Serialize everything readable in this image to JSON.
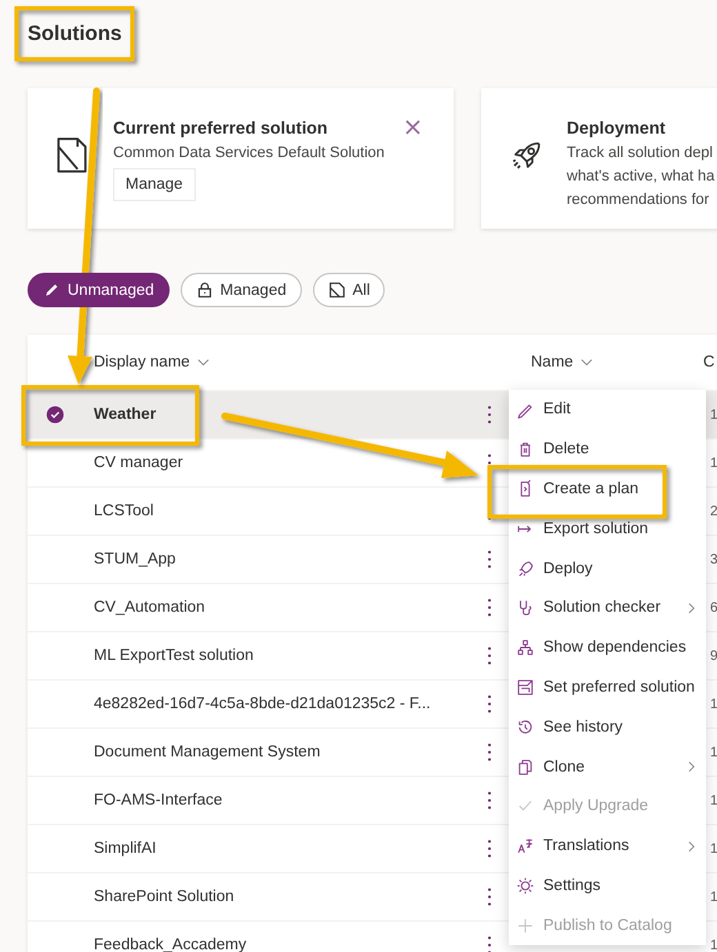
{
  "page": {
    "title": "Solutions"
  },
  "cards": [
    {
      "kind": "preferred",
      "title": "Current preferred solution",
      "lines": [
        "Common Data Services Default Solution"
      ],
      "button": "Manage",
      "close": "×"
    },
    {
      "kind": "deployment",
      "title": "Deployment",
      "lines": [
        "Track all solution depl",
        "what's active, what ha",
        "recommendations for"
      ]
    }
  ],
  "filters": [
    {
      "label": "Unmanaged",
      "selected": true
    },
    {
      "label": "Managed",
      "selected": false
    },
    {
      "label": "All",
      "selected": false
    }
  ],
  "table": {
    "columns": [
      "Display name",
      "Name",
      "C"
    ],
    "rows": [
      {
        "display_name": "Weather",
        "column_3": "1",
        "selected": true
      },
      {
        "display_name": "CV manager",
        "column_3": "1",
        "selected": false
      },
      {
        "display_name": "LCSTool",
        "column_3": "2",
        "selected": false
      },
      {
        "display_name": "STUM_App",
        "column_3": "3",
        "selected": false
      },
      {
        "display_name": "CV_Automation",
        "column_3": "6",
        "selected": false
      },
      {
        "display_name": "ML ExportTest solution",
        "column_3": "9",
        "selected": false
      },
      {
        "display_name": "4e8282ed-16d7-4c5a-8bde-d21da01235c2 - F...",
        "column_3": "1",
        "selected": false
      },
      {
        "display_name": "Document Management System",
        "column_3": "1",
        "selected": false
      },
      {
        "display_name": "FO-AMS-Interface",
        "column_3": "1",
        "selected": false
      },
      {
        "display_name": "SimplifAI",
        "column_3": "1",
        "selected": false
      },
      {
        "display_name": "SharePoint Solution",
        "column_3": "1",
        "selected": false
      },
      {
        "display_name": "Feedback_Accademy",
        "column_3": "1",
        "selected": false
      }
    ]
  },
  "context_menu": [
    {
      "label": "Edit",
      "disabled": false,
      "submenu": false
    },
    {
      "label": "Delete",
      "disabled": false,
      "submenu": false
    },
    {
      "label": "Create a plan",
      "disabled": false,
      "submenu": false
    },
    {
      "label": "Export solution",
      "disabled": false,
      "submenu": false
    },
    {
      "label": "Deploy",
      "disabled": false,
      "submenu": false
    },
    {
      "label": "Solution checker",
      "disabled": false,
      "submenu": true
    },
    {
      "label": "Show dependencies",
      "disabled": false,
      "submenu": false
    },
    {
      "label": "Set preferred solution",
      "disabled": false,
      "submenu": false
    },
    {
      "label": "See history",
      "disabled": false,
      "submenu": false
    },
    {
      "label": "Clone",
      "disabled": false,
      "submenu": true
    },
    {
      "label": "Apply Upgrade",
      "disabled": true,
      "submenu": false
    },
    {
      "label": "Translations",
      "disabled": false,
      "submenu": true
    },
    {
      "label": "Settings",
      "disabled": false,
      "submenu": false
    },
    {
      "label": "Publish to Catalog",
      "disabled": true,
      "submenu": false
    }
  ]
}
